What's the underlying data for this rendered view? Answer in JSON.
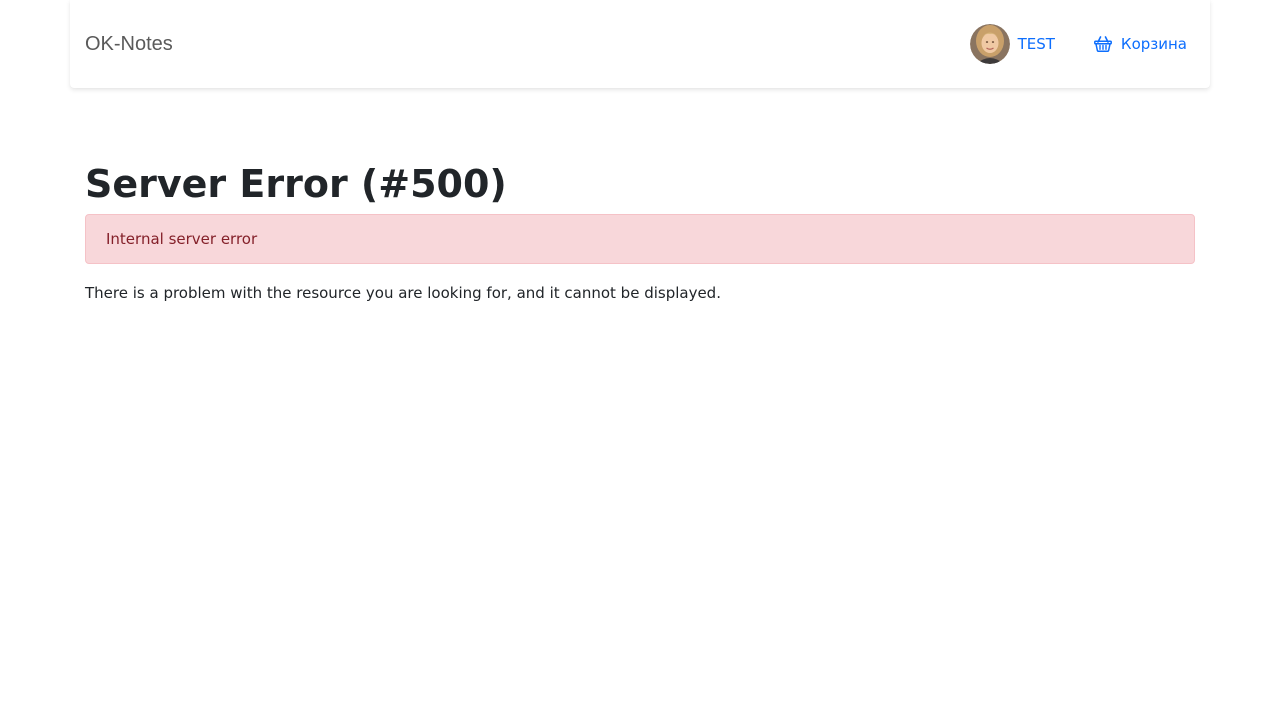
{
  "navbar": {
    "brand": "OK-Notes",
    "user": {
      "name": "TEST",
      "avatar_icon": "user-avatar"
    },
    "cart": {
      "label": "Корзина",
      "icon": "basket-icon"
    }
  },
  "main": {
    "title": "Server Error (#500)",
    "alert": "Internal server error",
    "message": "There is a problem with the resource you are looking for, and it cannot be displayed."
  },
  "colors": {
    "link": "#0d6efd",
    "alert_bg": "#f8d7da",
    "alert_border": "#f5c2c7",
    "alert_text": "#842029"
  }
}
